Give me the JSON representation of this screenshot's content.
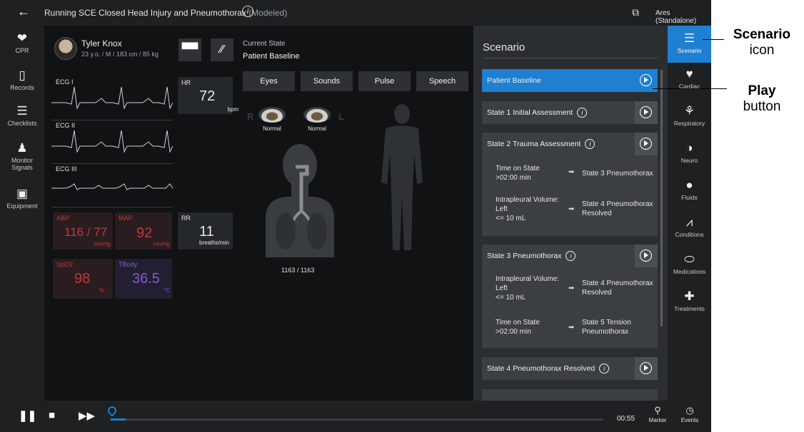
{
  "topbar": {
    "back_icon": "arrow-left-icon",
    "title": "Running SCE  Closed Head Injury and Pneumothorax",
    "title_suffix": "(Modeled)",
    "info_glyph": "i",
    "instance": "Ares (Standalone)"
  },
  "leftnav": [
    {
      "label": "CPR",
      "icon": "heart-pulse-icon",
      "glyph": "❤"
    },
    {
      "label": "Records",
      "icon": "clipboard-icon",
      "glyph": "▯"
    },
    {
      "label": "Checklists",
      "icon": "checklist-icon",
      "glyph": "☰"
    },
    {
      "label": "Monitor Signals",
      "icon": "monitor-signals-icon",
      "glyph": "♟"
    },
    {
      "label": "Equipment",
      "icon": "equipment-icon",
      "glyph": "▣"
    }
  ],
  "patient": {
    "name": "Tyler Knox",
    "info": "23 y.o. / M / 183 cm / 85 kg"
  },
  "current_state": {
    "label": "Current State",
    "value": "Patient Baseline"
  },
  "ecg": [
    "ECG I",
    "ECG II",
    "ECG III"
  ],
  "vitals": {
    "hr": {
      "label": "HR",
      "value": "72",
      "unit": "bpm",
      "color": "#e6e6e6"
    },
    "rr": {
      "label": "RR",
      "value": "11",
      "unit": "breaths/min",
      "color": "#e6e6e6"
    },
    "abp": {
      "label": "ABP",
      "value": "116 / 77",
      "unit": "mmHg",
      "color": "#c0393b"
    },
    "map": {
      "label": "MAP",
      "value": "92",
      "unit": "mmHg",
      "color": "#c0393b"
    },
    "spo2": {
      "label": "SpO2",
      "value": "98",
      "unit": "%",
      "color": "#c0393b"
    },
    "tbody": {
      "label": "TBody",
      "value": "36.5",
      "unit": "°C",
      "color": "#8a5ad0"
    }
  },
  "tabs": [
    "Eyes",
    "Sounds",
    "Pulse",
    "Speech"
  ],
  "eyes": {
    "right_label": "R",
    "left_label": "L",
    "right_status": "Normal",
    "left_status": "Normal"
  },
  "airway_counter": "1163 / 1163",
  "scenario": {
    "header": "Scenario",
    "states": [
      {
        "title": "Patient Baseline",
        "active": true,
        "info": false
      },
      {
        "title": "State 1 Initial Assessment",
        "info": true
      },
      {
        "title": "State 2 Trauma Assessment",
        "info": true,
        "transitions": [
          {
            "condition": "Time on State\n>02:00 min",
            "target": "State 3 Pneumothorax"
          },
          {
            "condition": "Intrapleural Volume:\nLeft\n<= 10 mL",
            "target": "State 4 Pneumothorax\nResolved"
          }
        ]
      },
      {
        "title": "State 3 Pneumothorax",
        "info": true,
        "transitions": [
          {
            "condition": "Intrapleural Volume:\nLeft\n<= 10 mL",
            "target": "State 4 Pneumothorax\nResolved"
          },
          {
            "condition": "Time on State\n>02:00 min",
            "target": "State 5 Tension\nPneumothorax"
          }
        ]
      },
      {
        "title": "State 4 Pneumothorax Resolved",
        "info": true
      }
    ]
  },
  "rightnav": [
    {
      "label": "Scenario",
      "icon": "list-icon",
      "glyph": "☰",
      "active": true
    },
    {
      "label": "Cardiac",
      "icon": "heart-icon",
      "glyph": "♥"
    },
    {
      "label": "Respiratory",
      "icon": "lungs-icon",
      "glyph": "⚘"
    },
    {
      "label": "Neuro",
      "icon": "brain-icon",
      "glyph": "◑"
    },
    {
      "label": "Fluids",
      "icon": "drop-icon",
      "glyph": "●"
    },
    {
      "label": "Conditions",
      "icon": "pulse-icon",
      "glyph": "⩘"
    },
    {
      "label": "Medications",
      "icon": "pill-icon",
      "glyph": "⬭"
    },
    {
      "label": "Treatments",
      "icon": "first-aid-icon",
      "glyph": "✚"
    }
  ],
  "bottom": {
    "time": "00:55",
    "marker_label": "Marker",
    "events_label": "Events",
    "progress_fraction": 0.03
  },
  "annotations": {
    "scenario_bold": "Scenario",
    "scenario_rest": "icon",
    "play_bold": "Play",
    "play_rest": "button"
  }
}
